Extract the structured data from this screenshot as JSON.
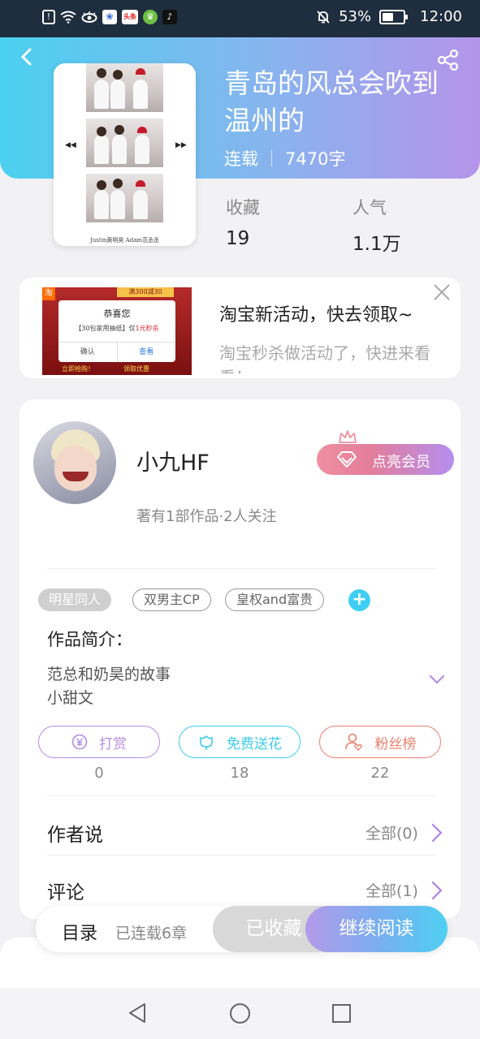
{
  "status_bar": {
    "battery": "53%",
    "time": "12:00",
    "icons": [
      "alert-icon",
      "wifi-icon",
      "eye-icon",
      "baidu-app-icon",
      "toutiao-app-icon",
      "wechat-app-icon",
      "tiktok-app-icon",
      "mute-icon",
      "battery-icon"
    ],
    "toutiao_label": "头条"
  },
  "header": {
    "title": "青岛的风总会吹到温州的",
    "status": "连载",
    "word_count": "7470字",
    "stats": [
      {
        "label": "收藏",
        "value": "19"
      },
      {
        "label": "人气",
        "value": "1.1万"
      }
    ],
    "cover_caption": "Justin黄明昊  Adam范丞丞"
  },
  "ad": {
    "title": "淘宝新活动，快去领取~",
    "subtitle": "淘宝秒杀做活动了，快进来看看！",
    "image": {
      "logo": "淘",
      "badge": "满300减30",
      "dialog_title": "恭喜您",
      "dialog_text": "【30包家用抽纸】仅1元秒杀",
      "dialog_text_plain": "【30包家用抽纸】仅",
      "dialog_text_price": "1元秒杀",
      "confirm": "确认",
      "view": "查看",
      "footer": "立即抢购！",
      "footer2": "领取优惠"
    }
  },
  "author": {
    "name": "小九HF",
    "stats": "著有1部作品·2人关注",
    "vip_label": "点亮会员"
  },
  "tags": [
    "明星同人",
    "双男主CP",
    "皇权and富贵"
  ],
  "intro": {
    "label": "作品简介：",
    "lines": [
      "范总和奶昊的故事",
      "小甜文"
    ]
  },
  "actions": [
    {
      "label": "打赏",
      "count": "0",
      "color": "#b58de6"
    },
    {
      "label": "免费送花",
      "count": "18",
      "color": "#3fcdeb"
    },
    {
      "label": "粉丝榜",
      "count": "22",
      "color": "#e9806f"
    }
  ],
  "rows": [
    {
      "label": "作者说",
      "right": "全部(0)"
    },
    {
      "label": "评论",
      "right": "全部(1)"
    }
  ],
  "bottom_bar": {
    "toc": "目录",
    "chapters": "已连载6章",
    "favorited": "已收藏",
    "continue": "继续阅读"
  },
  "colors": {
    "header_start": "#4bd0f0",
    "header_end": "#b594ea",
    "accent_purple": "#a97be6",
    "accent_cyan": "#3fcff3"
  }
}
